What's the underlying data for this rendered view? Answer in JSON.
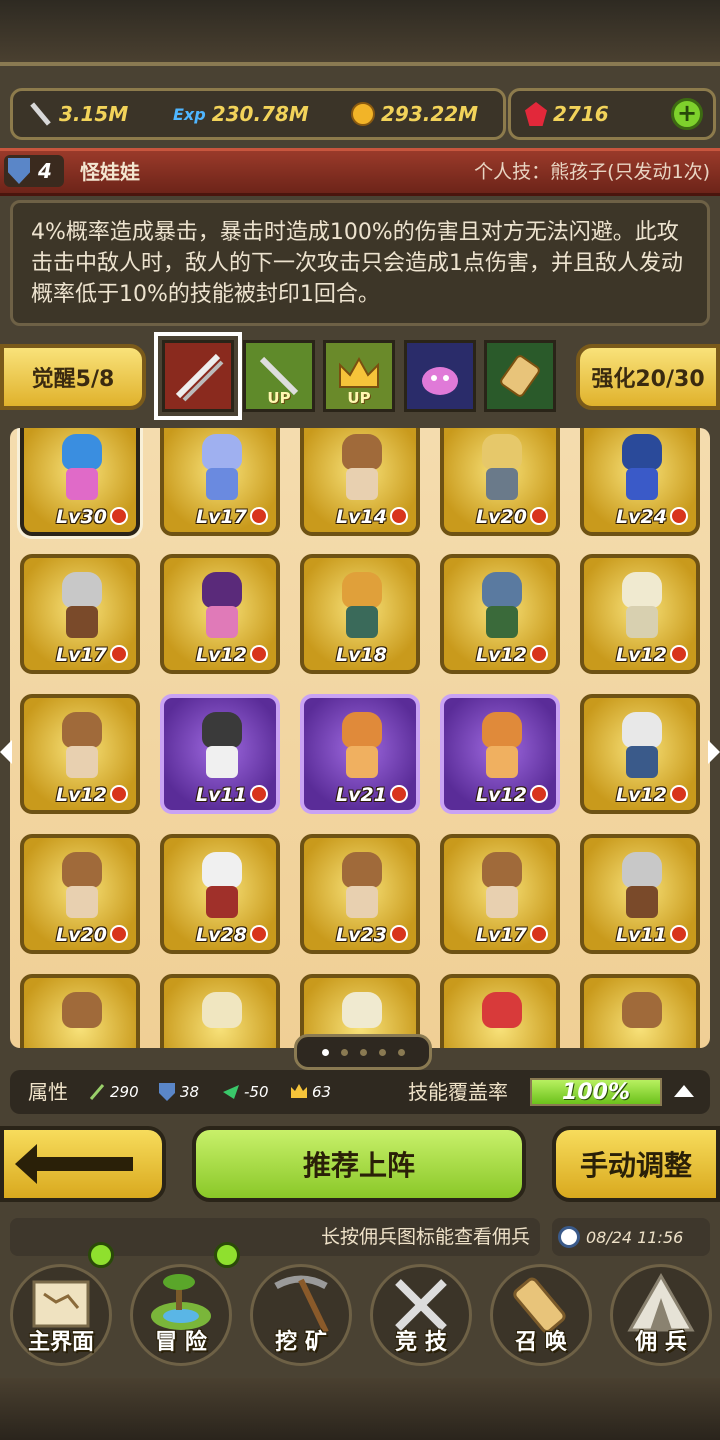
{
  "currency": {
    "attack": "3.15M",
    "exp_icon": "Exp",
    "exp": "230.78M",
    "gold": "293.22M",
    "gems": "2716"
  },
  "hero": {
    "level": "4",
    "name": "怪娃娃",
    "personal_skill": "个人技：熊孩子(只发动1次)",
    "description": "4%概率造成暴击，暴击时造成100%的伤害且对方无法闪避。此攻击击中敌人时，敌人的下一次攻击只会造成1点伤害，并且敌人发动概率低于10%的技能被封印1回合。"
  },
  "tabs": {
    "awaken": "觉醒5/8",
    "enhance": "强化20/30",
    "up_label": "UP"
  },
  "roster": [
    {
      "lv": "Lv30"
    },
    {
      "lv": "Lv17"
    },
    {
      "lv": "Lv14"
    },
    {
      "lv": "Lv20"
    },
    {
      "lv": "Lv24"
    },
    {
      "lv": "Lv17"
    },
    {
      "lv": "Lv12"
    },
    {
      "lv": "Lv18"
    },
    {
      "lv": "Lv12"
    },
    {
      "lv": "Lv12"
    },
    {
      "lv": "Lv12"
    },
    {
      "lv": "Lv11"
    },
    {
      "lv": "Lv21"
    },
    {
      "lv": "Lv12"
    },
    {
      "lv": "Lv12"
    },
    {
      "lv": "Lv20"
    },
    {
      "lv": "Lv28"
    },
    {
      "lv": "Lv23"
    },
    {
      "lv": "Lv17"
    },
    {
      "lv": "Lv11"
    }
  ],
  "attributes": {
    "label": "属性",
    "sword": "290",
    "shield": "38",
    "wing": "-50",
    "crown": "63",
    "coverage_label": "技能覆盖率",
    "coverage": "100%",
    "coverage_fraction": 1.0
  },
  "actions": {
    "recommend": "推荐上阵",
    "manual": "手动调整"
  },
  "hint": "长按佣兵图标能查看佣兵",
  "datetime": "08/24 11:56",
  "nav": {
    "main": "主界面",
    "adventure": "冒 险",
    "mining": "挖 矿",
    "arena": "竞 技",
    "summon": "召 唤",
    "mercenary": "佣 兵"
  }
}
